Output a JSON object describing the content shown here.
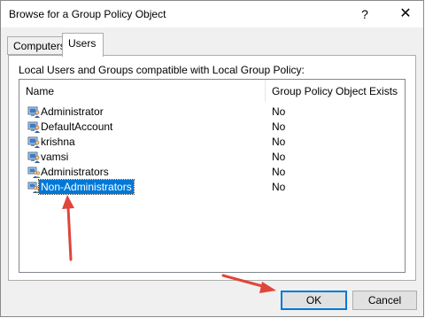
{
  "window": {
    "title": "Browse for a Group Policy Object",
    "help_glyph": "?",
    "close_glyph": "✕"
  },
  "tabs": [
    {
      "label": "Computers",
      "selected": false
    },
    {
      "label": "Users",
      "selected": true
    }
  ],
  "panel": {
    "caption": "Local Users and Groups compatible with Local Group Policy:"
  },
  "list": {
    "columns": [
      "Name",
      "Group Policy Object Exists"
    ],
    "rows": [
      {
        "name": "Administrator",
        "gpo": "No",
        "icon": "user-icon"
      },
      {
        "name": "DefaultAccount",
        "gpo": "No",
        "icon": "user-icon"
      },
      {
        "name": "krishna",
        "gpo": "No",
        "icon": "user-icon"
      },
      {
        "name": "vamsi",
        "gpo": "No",
        "icon": "user-icon"
      },
      {
        "name": "Administrators",
        "gpo": "No",
        "icon": "group-icon"
      },
      {
        "name": "Non-Administrators",
        "gpo": "No",
        "icon": "group-icon",
        "selected": true
      }
    ]
  },
  "buttons": {
    "ok": "OK",
    "cancel": "Cancel"
  },
  "colors": {
    "accent": "#0078d7",
    "annotation_arrow": "#e0453a"
  }
}
